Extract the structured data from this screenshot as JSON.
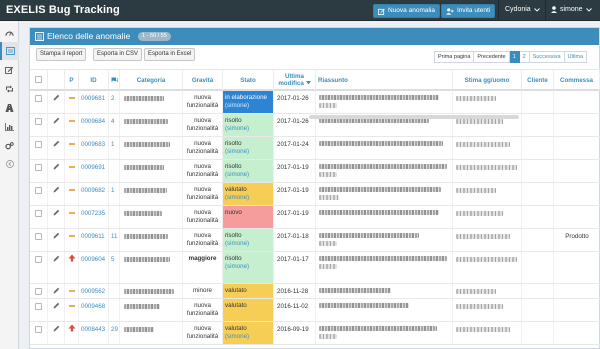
{
  "app": {
    "brand": "EXELIS Bug Tracking",
    "new_issue": "Nuova anomalia",
    "invite_users": "Invita utenti",
    "project": "Cydonia",
    "user": "simone"
  },
  "colors": {
    "accent": "#3c8dbc",
    "state_blue": "#2d84d3",
    "state_green": "#c6efd0",
    "state_orange": "#f7ce55",
    "state_red": "#f59c9c"
  },
  "sidebar_icons": [
    "dashboard-icon",
    "list-icon",
    "edit-icon",
    "retweet-icon",
    "road-icon",
    "bar-chart-icon",
    "gears-icon",
    "collapse-arrow-icon"
  ],
  "panel": {
    "title": "Elenco delle anomalie",
    "count": "1 - 50 / 55"
  },
  "toolbar": {
    "print": "Stampa il report",
    "csv": "Esporta in CSV",
    "excel": "Esporta in Excel"
  },
  "pager": {
    "first": "Prima pagina",
    "prev": "Precedente",
    "p1": "1",
    "p2": "2",
    "next": "Successiva",
    "last": "Ultima"
  },
  "columns": {
    "p": "P",
    "id": "ID",
    "categoria": "Categoria",
    "gravita": "Gravità",
    "stato": "Stato",
    "ultima": "Ultima modifica",
    "riassunto": "Riassunto",
    "stima": "Stima gg/uomo",
    "cliente": "Cliente",
    "commessa": "Commessa"
  },
  "rows": [
    {
      "id": "0009681",
      "notes": "2",
      "prio": "normal",
      "grav1": "nuova",
      "grav2": "funzionalità",
      "state": "in elaborazione",
      "user": "(simone)",
      "color": "blue",
      "date": "2017-01-26",
      "client": ""
    },
    {
      "id": "0009684",
      "notes": "4",
      "prio": "normal",
      "grav1": "nuova",
      "grav2": "funzionalità",
      "state": "risolto",
      "user": "(simone)",
      "color": "green",
      "date": "2017-01-26",
      "client": ""
    },
    {
      "id": "0009683",
      "notes": "1",
      "prio": "normal",
      "grav1": "nuova",
      "grav2": "funzionalità",
      "state": "risolto",
      "user": "(simone)",
      "color": "green",
      "date": "2017-01-24",
      "client": ""
    },
    {
      "id": "0009691",
      "notes": "",
      "prio": "normal",
      "grav1": "nuova",
      "grav2": "funzionalità",
      "state": "risolto",
      "user": "(simone)",
      "color": "green",
      "date": "2017-01-19",
      "client": ""
    },
    {
      "id": "0009682",
      "notes": "1",
      "prio": "normal",
      "grav1": "nuova",
      "grav2": "funzionalità",
      "state": "valutato",
      "user": "(simone)",
      "color": "orange",
      "date": "2017-01-19",
      "client": ""
    },
    {
      "id": "0007235",
      "notes": "",
      "prio": "normal",
      "grav1": "nuova",
      "grav2": "funzionalità",
      "state": "nuovo",
      "user": "",
      "color": "red",
      "date": "2017-01-19",
      "client": ""
    },
    {
      "id": "0009611",
      "notes": "11",
      "prio": "normal",
      "grav1": "nuova",
      "grav2": "funzionalità",
      "state": "risolto",
      "user": "(simone)",
      "color": "green",
      "date": "2017-01-18",
      "client": "Prodotto"
    },
    {
      "id": "0009604",
      "notes": "5",
      "prio": "high",
      "grav1": "maggiore",
      "grav2": "",
      "state": "risolto",
      "user": "(simone)",
      "color": "green",
      "date": "2017-01-17",
      "client": ""
    },
    {
      "id": "0009562",
      "notes": "",
      "prio": "normal",
      "grav1": "minore",
      "grav2": "",
      "state": "valutato",
      "user": "",
      "color": "orange",
      "date": "2016-11-28",
      "client": ""
    },
    {
      "id": "0009468",
      "notes": "",
      "prio": "normal",
      "grav1": "nuova",
      "grav2": "funzionalità",
      "state": "valutato",
      "user": "",
      "color": "orange",
      "date": "2016-11-02",
      "client": ""
    },
    {
      "id": "0008443",
      "notes": "29",
      "prio": "high",
      "grav1": "nuova",
      "grav2": "funzionalità",
      "state": "valutato",
      "user": "(simone)",
      "color": "orange",
      "date": "2016-09-19",
      "client": ""
    }
  ]
}
